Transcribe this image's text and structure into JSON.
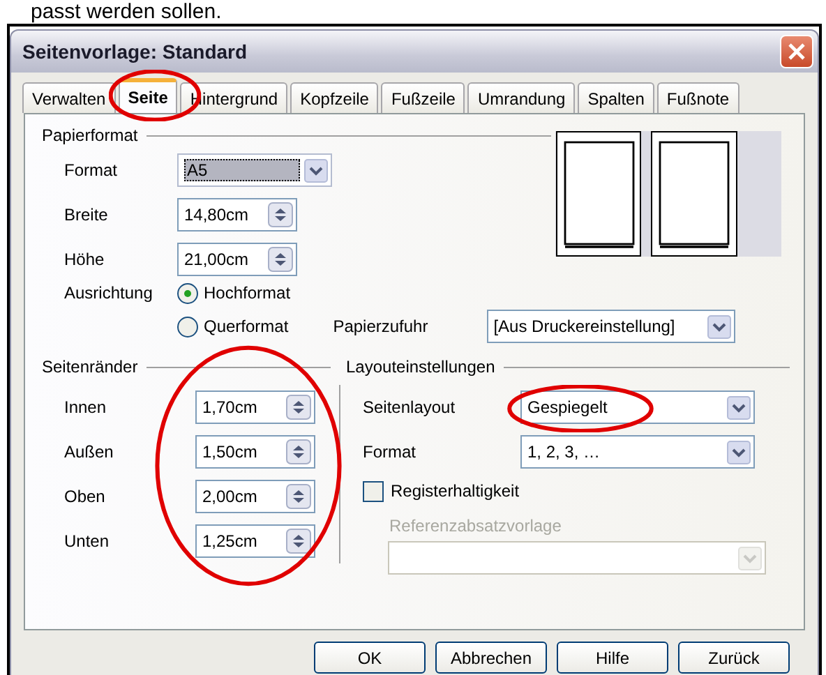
{
  "caption": "passt werden sollen.",
  "window": {
    "title": "Seitenvorlage: Standard"
  },
  "tabs": [
    {
      "label": "Verwalten",
      "selected": false,
      "highlighted": false
    },
    {
      "label": "Seite",
      "selected": true,
      "highlighted": true
    },
    {
      "label": "Hintergrund",
      "selected": false,
      "highlighted": false
    },
    {
      "label": "Kopfzeile",
      "selected": false,
      "highlighted": false
    },
    {
      "label": "Fußzeile",
      "selected": false,
      "highlighted": false
    },
    {
      "label": "Umrandung",
      "selected": false,
      "highlighted": false
    },
    {
      "label": "Spalten",
      "selected": false,
      "highlighted": false
    },
    {
      "label": "Fußnote",
      "selected": false,
      "highlighted": false
    }
  ],
  "paper": {
    "heading": "Papierformat",
    "format": {
      "label": "Format",
      "value": "A5"
    },
    "fields": [
      {
        "label": "Breite",
        "value": "14,80cm"
      },
      {
        "label": "Höhe",
        "value": "21,00cm"
      }
    ],
    "orientation": {
      "label": "Ausrichtung",
      "options": [
        {
          "label": "Hochformat",
          "selected": true
        },
        {
          "label": "Querformat",
          "selected": false
        }
      ]
    },
    "tray": {
      "label": "Papierzufuhr",
      "value": "[Aus Druckereinstellung]"
    }
  },
  "margins": {
    "heading": "Seitenränder",
    "highlighted": true,
    "fields": [
      {
        "label": "Innen",
        "value": "1,70cm"
      },
      {
        "label": "Außen",
        "value": "1,50cm"
      },
      {
        "label": "Oben",
        "value": "2,00cm"
      },
      {
        "label": "Unten",
        "value": "1,25cm"
      }
    ]
  },
  "layout": {
    "heading": "Layouteinstellungen",
    "page_layout": {
      "label": "Seitenlayout",
      "value": "Gespiegelt",
      "highlighted": true
    },
    "number_format": {
      "label": "Format",
      "value": "1, 2, 3, …"
    },
    "register": {
      "label": "Registerhaltigkeit",
      "checked": false
    },
    "reference": {
      "label": "Referenzabsatzvorlage",
      "disabled": true
    }
  },
  "buttons": [
    {
      "label": "OK"
    },
    {
      "label": "Abbrechen"
    },
    {
      "label": "Hilfe"
    },
    {
      "label": "Zurück"
    }
  ]
}
